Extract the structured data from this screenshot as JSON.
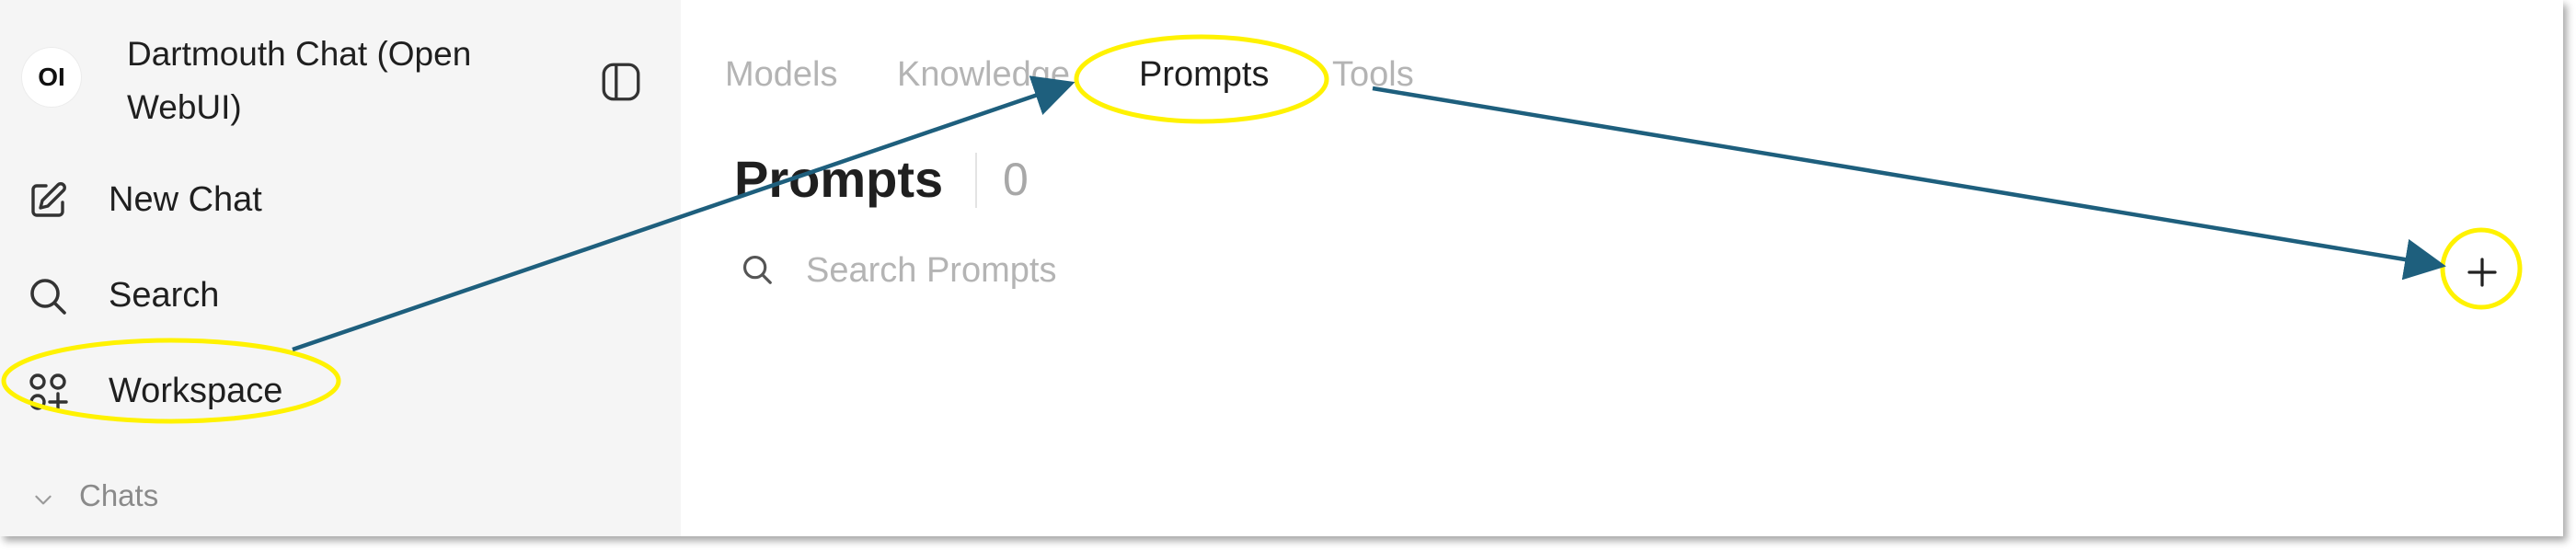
{
  "sidebar": {
    "logo_text": "OI",
    "app_title": "Dartmouth Chat (Open WebUI)",
    "items": [
      {
        "label": "New Chat",
        "icon": "edit-icon"
      },
      {
        "label": "Search",
        "icon": "search-icon"
      },
      {
        "label": "Workspace",
        "icon": "workspace-icon"
      }
    ],
    "chats_label": "Chats"
  },
  "tabs": [
    {
      "label": "Models",
      "active": false
    },
    {
      "label": "Knowledge",
      "active": false
    },
    {
      "label": "Prompts",
      "active": true
    },
    {
      "label": "Tools",
      "active": false
    }
  ],
  "main": {
    "title": "Prompts",
    "count": "0",
    "search_placeholder": "Search Prompts",
    "search_value": ""
  },
  "annotations": {
    "highlight_color": "#fff200",
    "arrow_color": "#1e5f7d"
  }
}
